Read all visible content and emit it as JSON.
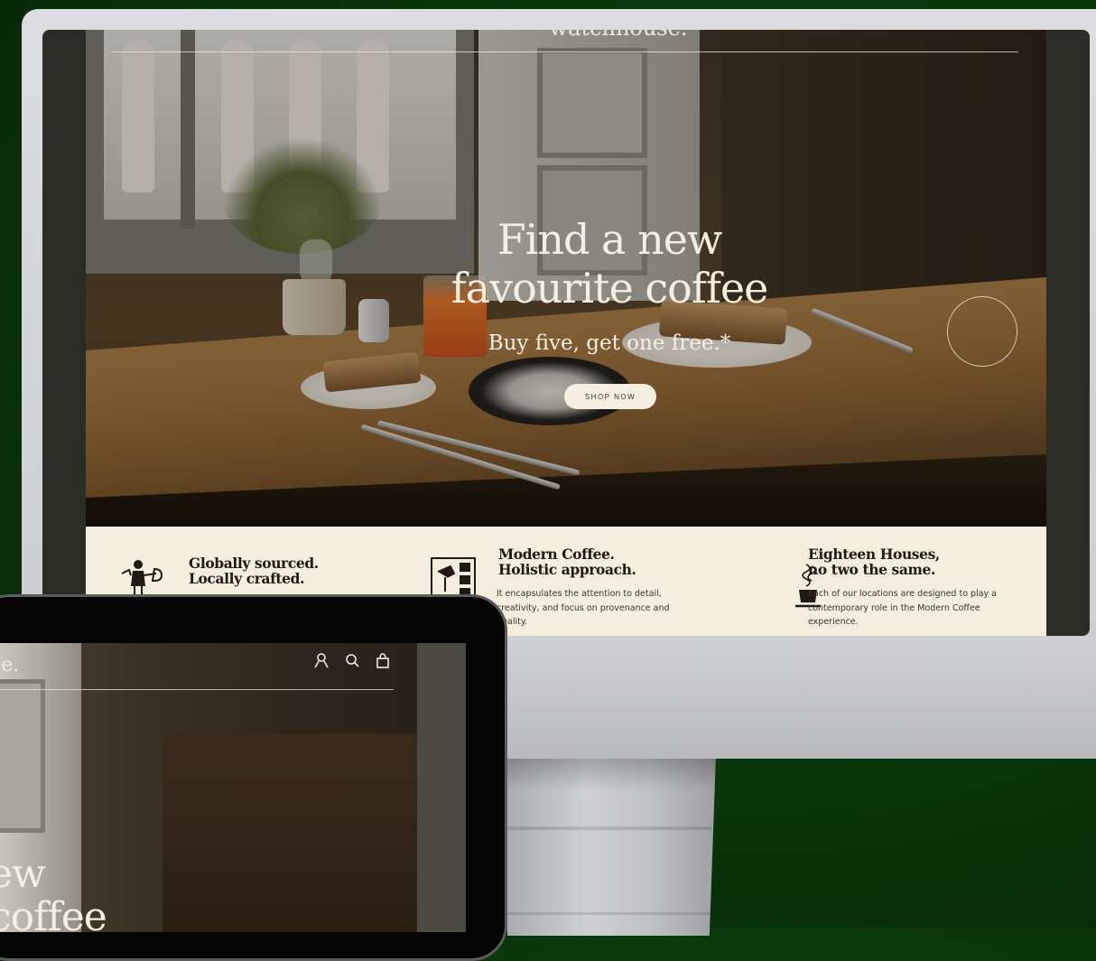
{
  "imac": {
    "site": {
      "logo": "watchhouse.",
      "hero": {
        "title_line1": "Find a new",
        "title_line2": "favourite coffee",
        "subtitle": "Buy five, get one free.*",
        "cta_label": "SHOP NOW"
      },
      "features": [
        {
          "icon": "barista-icon",
          "title_line1": "Globally sourced.",
          "title_line2": "Locally crafted.",
          "body_lines": []
        },
        {
          "icon": "coffee-machine-icon",
          "title_line1": "Modern Coffee.",
          "title_line2": "Holistic approach.",
          "body_lines": [
            "It encapsulates the attention to detail,",
            "creativity, and focus on provenance and",
            "quality."
          ]
        },
        {
          "icon": "steaming-cup-icon",
          "title_line1": "Eighteen Houses,",
          "title_line2": "no two the same.",
          "body_lines": [
            "Each of our locations are designed to play a",
            "contemporary role in the Modern Coffee",
            "experience."
          ]
        }
      ]
    },
    "camera_color": "#3fae7c"
  },
  "ipad": {
    "site": {
      "logo_fragment": "se.",
      "header_icons": [
        "account-icon",
        "search-icon",
        "bag-icon"
      ],
      "title_line1": "ew",
      "title_line2": "coffee"
    }
  },
  "colors": {
    "background": "#0a3a0c",
    "cream": "#f4eedf",
    "ink": "#1d1a14"
  }
}
